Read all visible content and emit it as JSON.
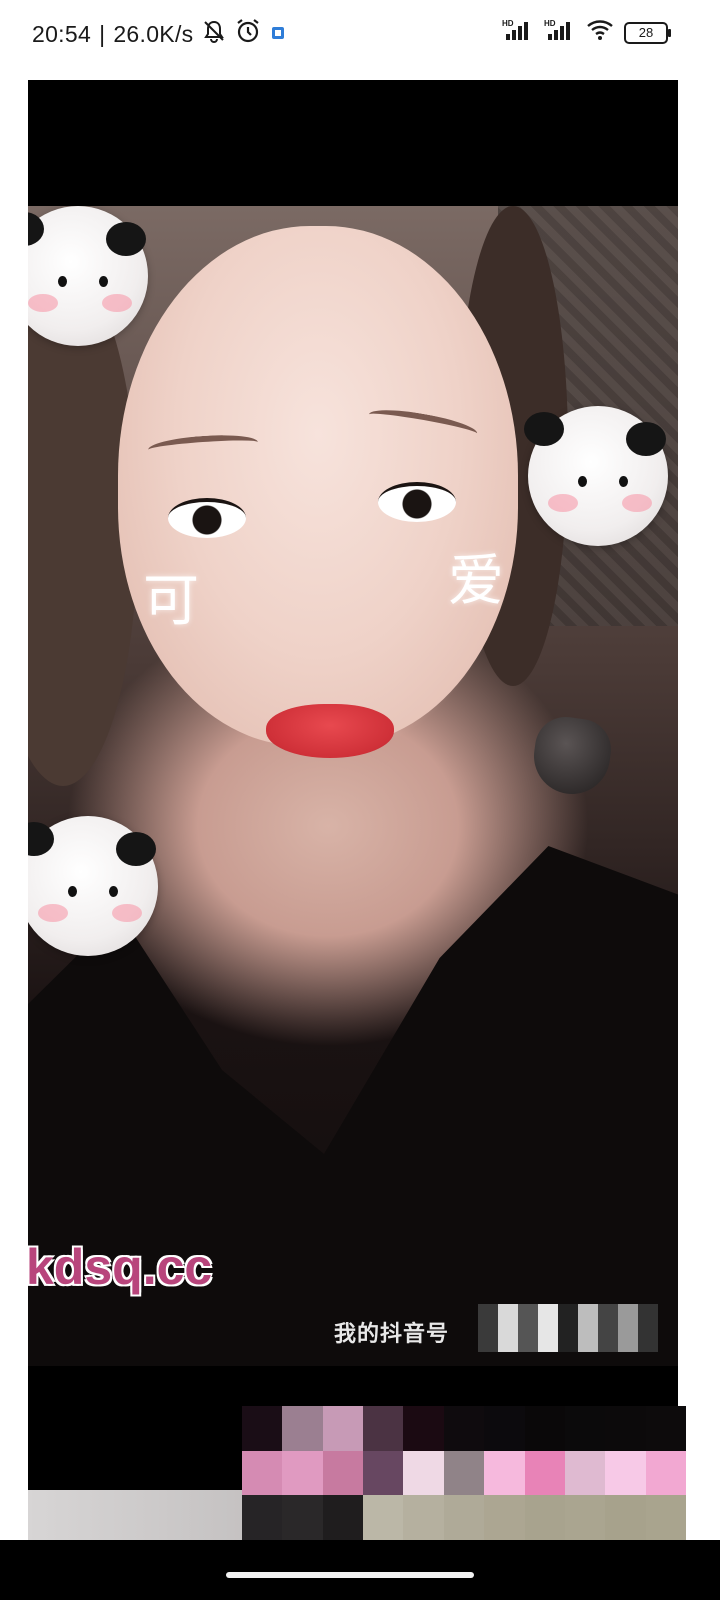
{
  "status_bar": {
    "time": "20:54",
    "separator": "|",
    "network_speed": "26.0K/s",
    "battery": "28",
    "icons": [
      "bell-muted-icon",
      "alarm-clock-icon",
      "app-notification-icon",
      "hd-signal-icon",
      "hd-signal-icon",
      "wifi-icon",
      "battery-icon"
    ]
  },
  "video": {
    "sticker_text_1": "可",
    "sticker_text_2": "爱",
    "watermark": "kdsq.cc",
    "douyin_label": "我的抖音号",
    "douyin_suffix": "a"
  },
  "colors": {
    "watermark": "#b8457c",
    "letterbox": "#000000"
  }
}
